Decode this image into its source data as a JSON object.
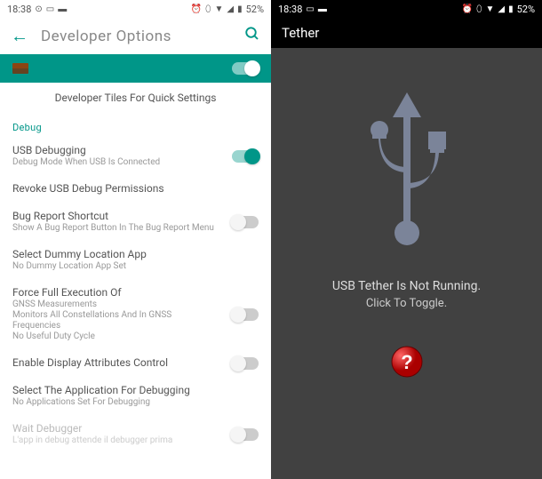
{
  "left": {
    "statusbar": {
      "time": "18:38",
      "battery": "52%"
    },
    "header": {
      "title": "Developer Options"
    },
    "banner": {
      "enabled": true
    },
    "quicksettings": {
      "title": "Developer Tiles For Quick Settings"
    },
    "debug_section": "Debug",
    "usb_debugging": {
      "title": "USB Debugging",
      "subtitle": "Debug Mode When USB Is Connected",
      "enabled": true
    },
    "revoke": {
      "title": "Revoke USB Debug Permissions"
    },
    "bug_report": {
      "title": "Bug Report Shortcut",
      "subtitle": "Show A Bug Report Button In The Bug Report Menu",
      "enabled": false
    },
    "dummy_location": {
      "title": "Select Dummy Location App",
      "subtitle": "No Dummy Location App Set"
    },
    "gnss": {
      "title": "Force Full Execution Of",
      "subtitle_line1": "GNSS Measurements",
      "subtitle_line2": "Monitors All Constellations And In GNSS Frequencies",
      "subtitle_line3": "No Useful Duty Cycle",
      "enabled": false
    },
    "display_attrs": {
      "title": "Enable Display Attributes Control",
      "enabled": false
    },
    "debug_app": {
      "title": "Select The Application For Debugging",
      "subtitle": "No Applications Set For Debugging"
    },
    "wait_debugger": {
      "title": "Wait Debugger",
      "subtitle": "L'app in debug attende il debugger prima",
      "enabled": false
    }
  },
  "right": {
    "statusbar": {
      "time": "18:38",
      "battery": "52%"
    },
    "header": {
      "title": "Tether"
    },
    "body": {
      "status": "USB Tether Is Not Running.",
      "hint": "Click To Toggle."
    }
  }
}
